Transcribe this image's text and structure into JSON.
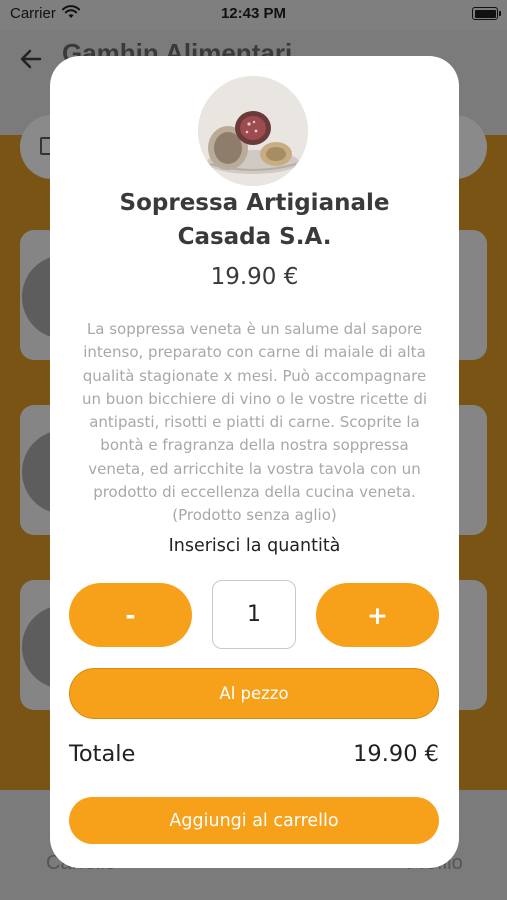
{
  "status_bar": {
    "carrier": "Carrier",
    "time": "12:43 PM"
  },
  "background": {
    "header_title": "Gamhin Alimentari",
    "tab_left": "Carrello",
    "tab_right": "Profilo"
  },
  "product": {
    "image_icon": "salami-photo",
    "name": "Sopressa Artigianale Casada S.A.",
    "price": "19.90 €",
    "description": "La soppressa veneta è un salume dal sapore intenso, preparato con carne di maiale di alta qualità stagionate x mesi. Può accompagnare un buon bicchiere di vino o le vostre ricette di antipasti, risotti e piatti di carne. Scoprite la bontà e fragranza della nostra soppressa veneta, ed arricchite la vostra tavola con un prodotto di eccellenza della cucina veneta. (Prodotto senza aglio)"
  },
  "quantity": {
    "label": "Inserisci la quantità",
    "minus_label": "-",
    "plus_label": "+",
    "value": "1",
    "unit_label": "Al pezzo"
  },
  "total": {
    "label": "Totale",
    "value": "19.90 €"
  },
  "actions": {
    "add_to_cart_label": "Aggiungi al carrello"
  },
  "colors": {
    "accent": "#f7a11a",
    "modal_bg": "#ffffff",
    "text_dark": "#3a3a3a",
    "text_muted": "#a8a8a8"
  }
}
